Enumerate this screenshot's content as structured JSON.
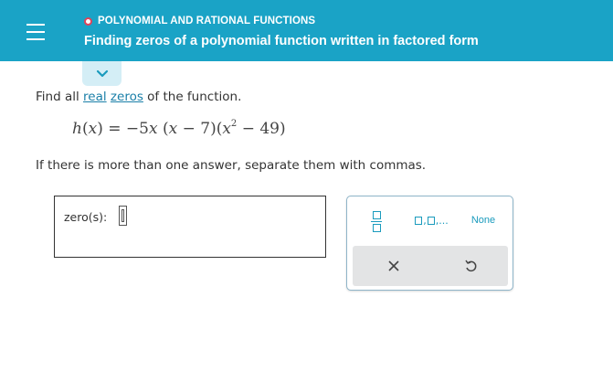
{
  "header": {
    "topic": "POLYNOMIAL AND RATIONAL FUNCTIONS",
    "title": "Finding zeros of a polynomial function written in factored form",
    "background_color": "#1aa3c6"
  },
  "question": {
    "prompt_before": "Find all ",
    "link_real": "real",
    "link_zeros": "zeros",
    "prompt_after": " of the function.",
    "instruction": "If there is more than one answer, separate them with commas."
  },
  "equation": {
    "lhs_func": "h",
    "lhs_var": "x",
    "equals_coeff": "= −5",
    "var": "x",
    "factor1_var": "x",
    "factor1_rest": " − 7",
    "factor2_var": "x",
    "factor2_exp": "2",
    "factor2_rest": " − 49"
  },
  "answer": {
    "label": "zero(s):",
    "value": ""
  },
  "palette": {
    "list_suffix": ",...",
    "none_label": "None",
    "clear_icon": "close-icon",
    "undo_icon": "undo-icon",
    "accent_color": "#1a9bbd"
  }
}
